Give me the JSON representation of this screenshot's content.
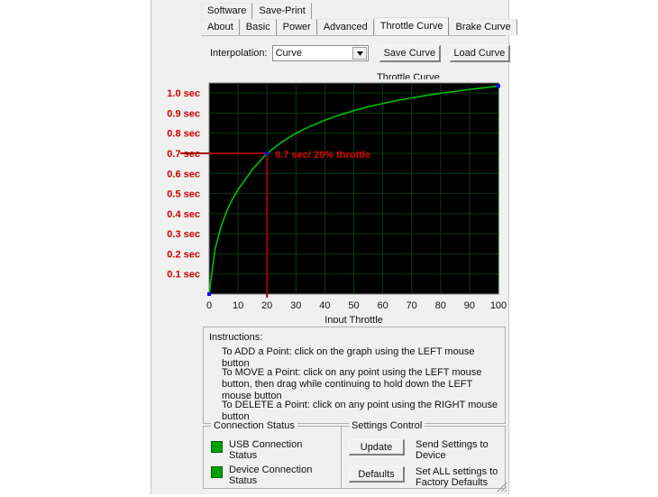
{
  "window": {
    "tab_rows": [
      {
        "tabs": [
          {
            "label": "Software",
            "selected": false
          },
          {
            "label": "Save-Print",
            "selected": false
          }
        ]
      },
      {
        "tabs": [
          {
            "label": "About",
            "selected": false
          },
          {
            "label": "Basic",
            "selected": false
          },
          {
            "label": "Power",
            "selected": false
          },
          {
            "label": "Advanced",
            "selected": false
          },
          {
            "label": "Throttle Curve",
            "selected": true
          },
          {
            "label": "Brake Curve",
            "selected": false
          }
        ]
      }
    ]
  },
  "toolbar": {
    "interpolation_label": "Interpolation:",
    "interpolation_value": "Curve",
    "dropdown_icon": "chevron-down-icon",
    "save_curve_label": "Save Curve",
    "load_curve_label": "Load Curve"
  },
  "chart_data": {
    "type": "line",
    "title": "Throttle Curve",
    "xlabel": "Input Throttle",
    "ylabel": "",
    "xlim": [
      0,
      100
    ],
    "ylim": [
      0,
      1.05
    ],
    "grid": true,
    "legend": "none",
    "plot_bg": "#000000",
    "grid_color": "#0c3a0c",
    "line_color": "#00c000",
    "point_color": "#0000ff",
    "annotation_color": "#cc0000",
    "axis_label_color": "#cc0000",
    "xticks": [
      0,
      10,
      20,
      30,
      40,
      50,
      60,
      70,
      80,
      90,
      100
    ],
    "xtick_labels": [
      "0",
      "10",
      "20",
      "30",
      "40",
      "50",
      "60",
      "70",
      "80",
      "90",
      "100"
    ],
    "yticks": [
      0.1,
      0.2,
      0.3,
      0.4,
      0.5,
      0.6,
      0.7,
      0.8,
      0.9,
      1.0
    ],
    "ytick_labels": [
      "0.1 sec",
      "0.2 sec",
      "0.3 sec",
      "0.4 sec",
      "0.5 sec",
      "0.6 sec",
      "0.7 sec",
      "0.8 sec",
      "0.9 sec",
      "1.0 sec"
    ],
    "x": [
      0,
      2,
      4,
      6,
      8,
      10,
      12,
      15,
      20,
      25,
      30,
      35,
      40,
      45,
      50,
      55,
      60,
      65,
      70,
      75,
      80,
      85,
      90,
      95,
      100
    ],
    "y": [
      0.0,
      0.22,
      0.33,
      0.41,
      0.47,
      0.52,
      0.56,
      0.62,
      0.7,
      0.755,
      0.8,
      0.835,
      0.865,
      0.89,
      0.912,
      0.932,
      0.948,
      0.963,
      0.976,
      0.988,
      0.999,
      1.008,
      1.018,
      1.026,
      1.035
    ],
    "control_points": [
      {
        "x": 0,
        "y": 0.0
      },
      {
        "x": 20,
        "y": 0.7
      },
      {
        "x": 100,
        "y": 1.035
      }
    ],
    "annotation": {
      "text": "0.7 sec/ 20% throttle",
      "x": 20,
      "y": 0.7
    },
    "crosshair": {
      "x": 20,
      "y": 0.7
    }
  },
  "instructions": {
    "heading": "Instructions:",
    "add": "To ADD a Point:  click on the graph using the LEFT mouse button",
    "move": "To MOVE a Point:  click on any point using the LEFT mouse button, then drag while continuing to hold down the LEFT mouse button",
    "delete": "To DELETE a Point:  click on any point using the RIGHT mouse button"
  },
  "connection_status": {
    "title": "Connection Status",
    "led_color": "#00a000",
    "items": [
      {
        "label": "USB Connection\nStatus"
      },
      {
        "label": "Device Connection\nStatus"
      }
    ]
  },
  "settings_control": {
    "title": "Settings Control",
    "items": [
      {
        "button": "Update",
        "description": "Send Settings to\nDevice"
      },
      {
        "button": "Defaults",
        "description": "Set ALL settings to\nFactory Defaults"
      }
    ]
  }
}
